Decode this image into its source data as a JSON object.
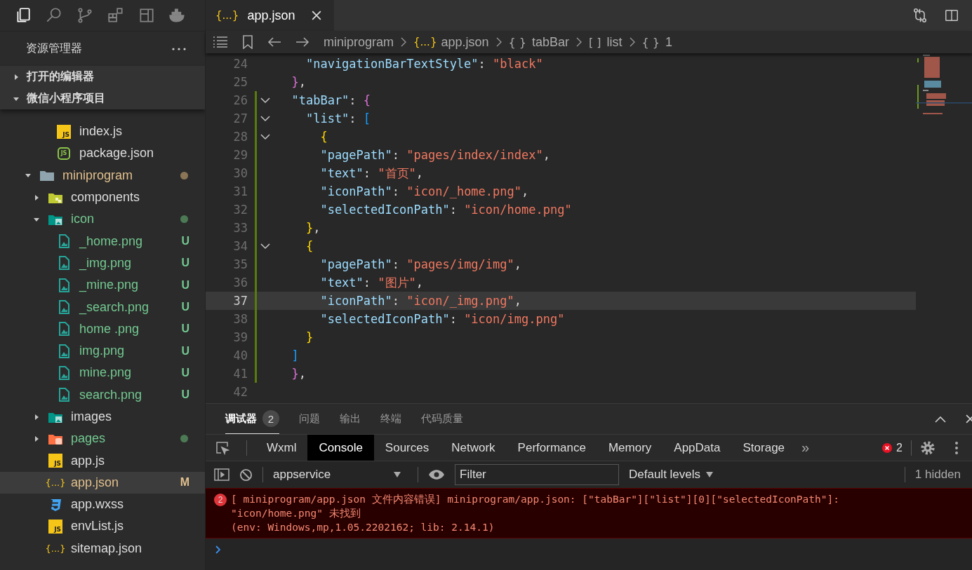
{
  "activity_bar": [
    {
      "kind": "files",
      "selected": true
    },
    {
      "kind": "search",
      "selected": false
    },
    {
      "kind": "source-control",
      "selected": false
    },
    {
      "kind": "extensions",
      "selected": false
    },
    {
      "kind": "layout",
      "selected": false
    },
    {
      "kind": "docker",
      "selected": false
    }
  ],
  "sidebar": {
    "title": "资源管理器",
    "sections": [
      {
        "label": "打开的编辑器",
        "expanded": false
      },
      {
        "label": "微信小程序项目",
        "expanded": true
      }
    ],
    "tree": {
      "partial_folder_children": [
        {
          "name": "index.js",
          "kind": "js",
          "icon_text": "JS",
          "untracked": false,
          "modified": false,
          "selected": false
        },
        {
          "name": "package.json",
          "kind": "node",
          "icon_text": "JS",
          "untracked": false,
          "modified": false,
          "selected": false
        }
      ],
      "items": [
        {
          "name": "miniprogram",
          "kind": "folder",
          "untracked": false,
          "modified": true,
          "color": "#8a7656",
          "expanded": true,
          "selected": false,
          "children": [
            {
              "name": "components",
              "kind": "folder-components",
              "untracked": false,
              "modified": false,
              "expanded": false,
              "selected": false
            },
            {
              "name": "icon",
              "kind": "folder-image",
              "untracked": true,
              "modified": false,
              "color": "#4c7a55",
              "expanded": true,
              "selected": false,
              "children": [
                {
                  "name": "_home.png",
                  "kind": "image",
                  "untracked": true,
                  "modified": false,
                  "badge": "U",
                  "selected": false
                },
                {
                  "name": "_img.png",
                  "kind": "image",
                  "untracked": true,
                  "modified": false,
                  "badge": "U",
                  "selected": false
                },
                {
                  "name": "_mine.png",
                  "kind": "image",
                  "untracked": true,
                  "modified": false,
                  "badge": "U",
                  "selected": false
                },
                {
                  "name": "_search.png",
                  "kind": "image",
                  "untracked": true,
                  "modified": false,
                  "badge": "U",
                  "selected": false
                },
                {
                  "name": "home .png",
                  "kind": "image",
                  "untracked": true,
                  "modified": false,
                  "badge": "U",
                  "selected": false
                },
                {
                  "name": "img.png",
                  "kind": "image",
                  "untracked": true,
                  "modified": false,
                  "badge": "U",
                  "selected": false
                },
                {
                  "name": "mine.png",
                  "kind": "image",
                  "untracked": true,
                  "modified": false,
                  "badge": "U",
                  "selected": false
                },
                {
                  "name": "search.png",
                  "kind": "image",
                  "untracked": true,
                  "modified": false,
                  "badge": "U",
                  "selected": false
                }
              ]
            },
            {
              "name": "images",
              "kind": "folder-image",
              "untracked": false,
              "modified": false,
              "expanded": false,
              "selected": false
            },
            {
              "name": "pages",
              "kind": "folder-pages",
              "untracked": true,
              "modified": false,
              "color": "#4c7a55",
              "expanded": false,
              "selected": false
            },
            {
              "name": "app.js",
              "kind": "js",
              "icon_text": "JS",
              "untracked": false,
              "modified": false,
              "selected": false
            },
            {
              "name": "app.json",
              "kind": "json",
              "icon_text": "{...}",
              "untracked": false,
              "modified": true,
              "badge": "M",
              "selected": true
            },
            {
              "name": "app.wxss",
              "kind": "css",
              "untracked": false,
              "modified": false,
              "selected": false
            },
            {
              "name": "envList.js",
              "kind": "js",
              "icon_text": "JS",
              "untracked": false,
              "modified": false,
              "selected": false
            },
            {
              "name": "sitemap.json",
              "kind": "json",
              "icon_text": "{...}",
              "untracked": false,
              "modified": false,
              "selected": false
            }
          ]
        }
      ]
    }
  },
  "editor": {
    "tabs": [
      {
        "label": "app.json",
        "icon_text": "{...}",
        "selected": true
      }
    ],
    "breadcrumbs": [
      {
        "kind": "folder",
        "label": "miniprogram"
      },
      {
        "kind": "json",
        "icon_text": "{...}",
        "label": "app.json"
      },
      {
        "kind": "object",
        "icon_text": "{ }",
        "label": "tabBar"
      },
      {
        "kind": "array",
        "icon_text": "[ ]",
        "label": "list"
      },
      {
        "kind": "object",
        "icon_text": "{ }",
        "label": "1"
      }
    ],
    "lines": [
      {
        "number": "24",
        "fold": false,
        "changed": false,
        "current": false,
        "tokens": [
          {
            "t": "    \"navigationBarTextStyle\"",
            "kind": "key"
          },
          {
            "t": ": ",
            "kind": "p"
          },
          {
            "t": "\"black\"",
            "kind": "str"
          }
        ]
      },
      {
        "number": "25",
        "fold": false,
        "changed": false,
        "current": false,
        "tokens": [
          {
            "t": "  }",
            "kind": "b2"
          },
          {
            "t": ",",
            "kind": "p"
          }
        ]
      },
      {
        "number": "26",
        "fold": true,
        "changed": true,
        "current": false,
        "tokens": [
          {
            "t": "  \"tabBar\"",
            "kind": "key"
          },
          {
            "t": ": ",
            "kind": "p"
          },
          {
            "t": "{",
            "kind": "b2"
          }
        ]
      },
      {
        "number": "27",
        "fold": true,
        "changed": true,
        "current": false,
        "tokens": [
          {
            "t": "    \"list\"",
            "kind": "key"
          },
          {
            "t": ": ",
            "kind": "p"
          },
          {
            "t": "[",
            "kind": "b3"
          }
        ]
      },
      {
        "number": "28",
        "fold": true,
        "changed": true,
        "current": false,
        "tokens": [
          {
            "t": "      {",
            "kind": "b1"
          }
        ]
      },
      {
        "number": "29",
        "fold": false,
        "changed": true,
        "current": false,
        "tokens": [
          {
            "t": "      \"pagePath\"",
            "kind": "key"
          },
          {
            "t": ": ",
            "kind": "p"
          },
          {
            "t": "\"pages/index/index\"",
            "kind": "str"
          },
          {
            "t": ",",
            "kind": "p"
          }
        ]
      },
      {
        "number": "30",
        "fold": false,
        "changed": true,
        "current": false,
        "tokens": [
          {
            "t": "      \"text\"",
            "kind": "key"
          },
          {
            "t": ": ",
            "kind": "p"
          },
          {
            "t": "\"首页\"",
            "kind": "str"
          },
          {
            "t": ",",
            "kind": "p"
          }
        ]
      },
      {
        "number": "31",
        "fold": false,
        "changed": true,
        "current": false,
        "tokens": [
          {
            "t": "      \"iconPath\"",
            "kind": "key"
          },
          {
            "t": ": ",
            "kind": "p"
          },
          {
            "t": "\"icon/_home.png\"",
            "kind": "str"
          },
          {
            "t": ",",
            "kind": "p"
          }
        ]
      },
      {
        "number": "32",
        "fold": false,
        "changed": true,
        "current": false,
        "tokens": [
          {
            "t": "      \"selectedIconPath\"",
            "kind": "key"
          },
          {
            "t": ": ",
            "kind": "p"
          },
          {
            "t": "\"icon/home.png\"",
            "kind": "str"
          }
        ]
      },
      {
        "number": "33",
        "fold": false,
        "changed": true,
        "current": false,
        "tokens": [
          {
            "t": "    }",
            "kind": "b1"
          },
          {
            "t": ",",
            "kind": "p"
          }
        ]
      },
      {
        "number": "34",
        "fold": true,
        "changed": true,
        "current": false,
        "tokens": [
          {
            "t": "    {",
            "kind": "b1"
          }
        ]
      },
      {
        "number": "35",
        "fold": false,
        "changed": true,
        "current": false,
        "tokens": [
          {
            "t": "      \"pagePath\"",
            "kind": "key"
          },
          {
            "t": ": ",
            "kind": "p"
          },
          {
            "t": "\"pages/img/img\"",
            "kind": "str"
          },
          {
            "t": ",",
            "kind": "p"
          }
        ]
      },
      {
        "number": "36",
        "fold": false,
        "changed": true,
        "current": false,
        "tokens": [
          {
            "t": "      \"text\"",
            "kind": "key"
          },
          {
            "t": ": ",
            "kind": "p"
          },
          {
            "t": "\"图片\"",
            "kind": "str"
          },
          {
            "t": ",",
            "kind": "p"
          }
        ]
      },
      {
        "number": "37",
        "fold": false,
        "changed": true,
        "current": true,
        "tokens": [
          {
            "t": "      \"iconPath\"",
            "kind": "key"
          },
          {
            "t": ": ",
            "kind": "p"
          },
          {
            "t": "\"icon/_img.png\"",
            "kind": "str"
          },
          {
            "t": ",",
            "kind": "p"
          }
        ]
      },
      {
        "number": "38",
        "fold": false,
        "changed": true,
        "current": false,
        "tokens": [
          {
            "t": "      \"selectedIconPath\"",
            "kind": "key"
          },
          {
            "t": ": ",
            "kind": "p"
          },
          {
            "t": "\"icon/img.png\"",
            "kind": "str"
          }
        ]
      },
      {
        "number": "39",
        "fold": false,
        "changed": true,
        "current": false,
        "tokens": [
          {
            "t": "    }",
            "kind": "b1"
          }
        ]
      },
      {
        "number": "40",
        "fold": false,
        "changed": true,
        "current": false,
        "tokens": [
          {
            "t": "  ]",
            "kind": "b3"
          }
        ]
      },
      {
        "number": "41",
        "fold": false,
        "changed": true,
        "current": false,
        "tokens": [
          {
            "t": "  }",
            "kind": "b2"
          },
          {
            "t": ",",
            "kind": "p"
          }
        ]
      },
      {
        "number": "42",
        "fold": false,
        "changed": false,
        "current": false
      }
    ]
  },
  "panel": {
    "tabs": [
      {
        "label": "调试器",
        "badge": "2",
        "selected": true
      },
      {
        "label": "问题",
        "selected": false
      },
      {
        "label": "输出",
        "selected": false
      },
      {
        "label": "终端",
        "selected": false
      },
      {
        "label": "代码质量",
        "selected": false
      }
    ],
    "devtools_tabs": [
      {
        "label": "Wxml",
        "selected": false
      },
      {
        "label": "Console",
        "selected": true
      },
      {
        "label": "Sources",
        "selected": false
      },
      {
        "label": "Network",
        "selected": false
      },
      {
        "label": "Performance",
        "selected": false
      },
      {
        "label": "Memory",
        "selected": false
      },
      {
        "label": "AppData",
        "selected": false
      },
      {
        "label": "Storage",
        "selected": false
      }
    ],
    "more_tabs": "»",
    "error_count": "2",
    "context": "appservice",
    "filter_placeholder": "Filter",
    "levels": "Default levels",
    "hidden": "1 hidden",
    "messages": [
      {
        "kind": "error",
        "count": "2",
        "lines": [
          "[ miniprogram/app.json 文件内容错误] miniprogram/app.json: [\"tabBar\"][\"list\"][0][\"selectedIconPath\"]:",
          "\"icon/home.png\" 未找到",
          "(env: Windows,mp,1.05.2202162; lib: 2.14.1)"
        ]
      }
    ]
  }
}
